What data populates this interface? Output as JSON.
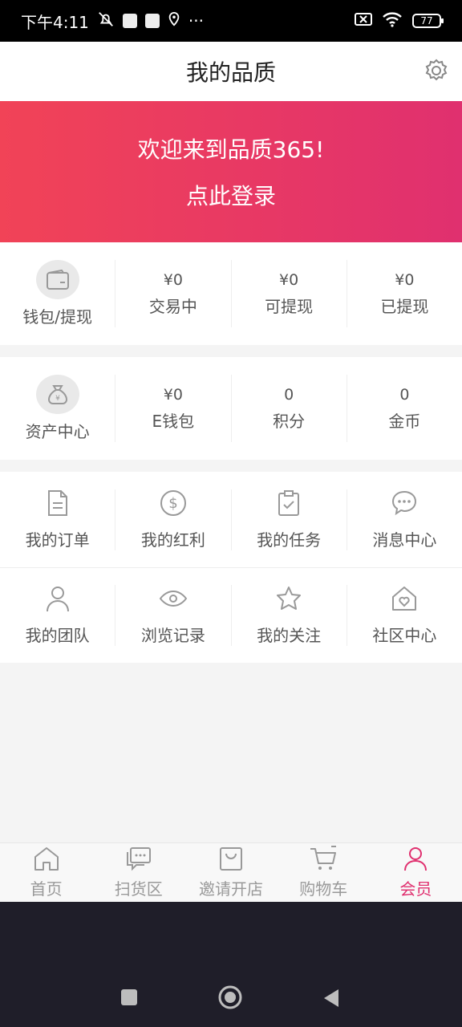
{
  "status": {
    "time": "下午4:11",
    "dots": "···",
    "battery": "77"
  },
  "header": {
    "title": "我的品质"
  },
  "banner": {
    "welcome": "欢迎来到品质365!",
    "login": "点此登录"
  },
  "wallet": {
    "label": "钱包/提现",
    "items": [
      {
        "value": "¥0",
        "label": "交易中"
      },
      {
        "value": "¥0",
        "label": "可提现"
      },
      {
        "value": "¥0",
        "label": "已提现"
      }
    ]
  },
  "assets": {
    "label": "资产中心",
    "items": [
      {
        "value": "¥0",
        "label": "E钱包"
      },
      {
        "value": "0",
        "label": "积分"
      },
      {
        "value": "0",
        "label": "金币"
      }
    ]
  },
  "menu": {
    "row1": [
      {
        "label": "我的订单",
        "icon": "document-icon"
      },
      {
        "label": "我的红利",
        "icon": "dollar-icon"
      },
      {
        "label": "我的任务",
        "icon": "clipboard-icon"
      },
      {
        "label": "消息中心",
        "icon": "chat-icon"
      }
    ],
    "row2": [
      {
        "label": "我的团队",
        "icon": "person-icon"
      },
      {
        "label": "浏览记录",
        "icon": "eye-icon"
      },
      {
        "label": "我的关注",
        "icon": "star-icon"
      },
      {
        "label": "社区中心",
        "icon": "house-heart-icon"
      }
    ]
  },
  "bottomnav": [
    {
      "label": "首页"
    },
    {
      "label": "扫货区"
    },
    {
      "label": "邀请开店"
    },
    {
      "label": "购物车"
    },
    {
      "label": "会员"
    }
  ],
  "colors": {
    "accent": "#e0306f",
    "banner_start": "#f14357",
    "banner_end": "#e0306f"
  }
}
